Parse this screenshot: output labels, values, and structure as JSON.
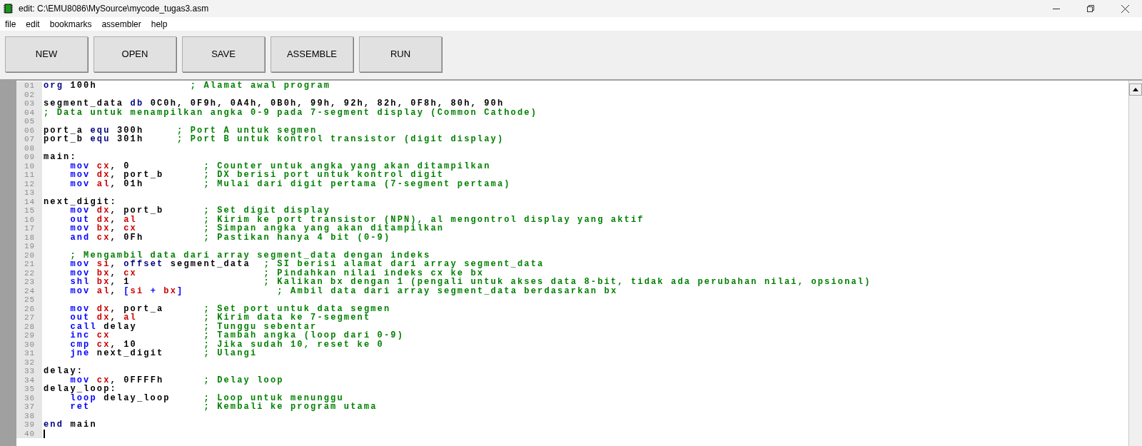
{
  "window": {
    "title": "edit: C:\\EMU8086\\MySource\\mycode_tugas3.asm"
  },
  "menu": [
    "file",
    "edit",
    "bookmarks",
    "assembler",
    "help"
  ],
  "toolbar": [
    "NEW",
    "OPEN",
    "SAVE",
    "ASSEMBLE",
    "RUN"
  ],
  "editor": {
    "lines": [
      {
        "number": "01",
        "cursor": false,
        "tokens": [
          {
            "text": "org",
            "kind": "directive"
          },
          {
            "text": " 100h              ",
            "kind": "plain"
          }
        ],
        "comment": "; Alamat awal program"
      },
      {
        "number": "02",
        "cursor": false
      },
      {
        "number": "03",
        "cursor": false,
        "tokens": [
          {
            "text": "segment_data ",
            "kind": "plain"
          },
          {
            "text": "db",
            "kind": "directive"
          },
          {
            "text": " 0C0h, 0F9h, 0A4h, 0B0h, 99h, 92h, 82h, 0F8h, 80h, 90h",
            "kind": "plain"
          }
        ]
      },
      {
        "number": "04",
        "cursor": false,
        "comment": "; Data untuk menampilkan angka 0-9 pada 7-segment display (Common Cathode)"
      },
      {
        "number": "05",
        "cursor": false
      },
      {
        "number": "06",
        "cursor": false,
        "tokens": [
          {
            "text": "port_a ",
            "kind": "plain"
          },
          {
            "text": "equ",
            "kind": "directive"
          },
          {
            "text": " 300h     ",
            "kind": "plain"
          }
        ],
        "comment": "; Port A untuk segmen"
      },
      {
        "number": "07",
        "cursor": false,
        "tokens": [
          {
            "text": "port_b ",
            "kind": "plain"
          },
          {
            "text": "equ",
            "kind": "directive"
          },
          {
            "text": " 301h     ",
            "kind": "plain"
          }
        ],
        "comment": "; Port B untuk kontrol transistor (digit display)"
      },
      {
        "number": "08",
        "cursor": false
      },
      {
        "number": "09",
        "cursor": false,
        "tokens": [
          {
            "text": "main:",
            "kind": "plain"
          }
        ]
      },
      {
        "number": "10",
        "cursor": false,
        "tokens": [
          {
            "text": "    mov",
            "kind": "instruction"
          },
          {
            "text": " cx",
            "kind": "register"
          },
          {
            "text": ", 0           ",
            "kind": "plain"
          }
        ],
        "comment": "; Counter untuk angka yang akan ditampilkan"
      },
      {
        "number": "11",
        "cursor": false,
        "tokens": [
          {
            "text": "    mov",
            "kind": "instruction"
          },
          {
            "text": " dx",
            "kind": "register"
          },
          {
            "text": ", port_b      ",
            "kind": "plain"
          }
        ],
        "comment": "; DX berisi port untuk kontrol digit"
      },
      {
        "number": "12",
        "cursor": false,
        "tokens": [
          {
            "text": "    mov",
            "kind": "instruction"
          },
          {
            "text": " al",
            "kind": "register"
          },
          {
            "text": ", 01h         ",
            "kind": "plain"
          }
        ],
        "comment": "; Mulai dari digit pertama (7-segment pertama)"
      },
      {
        "number": "13",
        "cursor": false
      },
      {
        "number": "14",
        "cursor": false,
        "tokens": [
          {
            "text": "next_digit:",
            "kind": "plain"
          }
        ]
      },
      {
        "number": "15",
        "cursor": false,
        "tokens": [
          {
            "text": "    mov",
            "kind": "instruction"
          },
          {
            "text": " dx",
            "kind": "register"
          },
          {
            "text": ", port_b      ",
            "kind": "plain"
          }
        ],
        "comment": "; Set digit display"
      },
      {
        "number": "16",
        "cursor": false,
        "tokens": [
          {
            "text": "    out",
            "kind": "instruction"
          },
          {
            "text": " dx",
            "kind": "register"
          },
          {
            "text": ", ",
            "kind": "plain"
          },
          {
            "text": "al          ",
            "kind": "register"
          }
        ],
        "comment": "; Kirim ke port transistor (NPN), al mengontrol display yang aktif"
      },
      {
        "number": "17",
        "cursor": false,
        "tokens": [
          {
            "text": "    mov",
            "kind": "instruction"
          },
          {
            "text": " bx",
            "kind": "register"
          },
          {
            "text": ", ",
            "kind": "plain"
          },
          {
            "text": "cx          ",
            "kind": "register"
          }
        ],
        "comment": "; Simpan angka yang akan ditampilkan"
      },
      {
        "number": "18",
        "cursor": false,
        "tokens": [
          {
            "text": "    and",
            "kind": "instruction"
          },
          {
            "text": " cx",
            "kind": "register"
          },
          {
            "text": ", 0Fh         ",
            "kind": "plain"
          }
        ],
        "comment": "; Pastikan hanya 4 bit (0-9)"
      },
      {
        "number": "19",
        "cursor": false
      },
      {
        "number": "20",
        "cursor": false,
        "comment": "    ; Mengambil data dari array segment_data dengan indeks"
      },
      {
        "number": "21",
        "cursor": false,
        "tokens": [
          {
            "text": "    mov",
            "kind": "instruction"
          },
          {
            "text": " si",
            "kind": "register"
          },
          {
            "text": ", ",
            "kind": "plain"
          },
          {
            "text": "offset",
            "kind": "directive"
          },
          {
            "text": " segment_data  ",
            "kind": "plain"
          }
        ],
        "comment": "; SI berisi alamat dari array segment_data"
      },
      {
        "number": "22",
        "cursor": false,
        "tokens": [
          {
            "text": "    mov",
            "kind": "instruction"
          },
          {
            "text": " bx",
            "kind": "register"
          },
          {
            "text": ", ",
            "kind": "plain"
          },
          {
            "text": "cx                   ",
            "kind": "register"
          }
        ],
        "comment": "; Pindahkan nilai indeks cx ke bx"
      },
      {
        "number": "23",
        "cursor": false,
        "tokens": [
          {
            "text": "    shl",
            "kind": "instruction"
          },
          {
            "text": " bx",
            "kind": "register"
          },
          {
            "text": ", 1                    ",
            "kind": "plain"
          }
        ],
        "comment": "; Kalikan bx dengan 1 (pengali untuk akses data 8-bit, tidak ada perubahan nilai, opsional)"
      },
      {
        "number": "24",
        "cursor": false,
        "tokens": [
          {
            "text": "    mov",
            "kind": "instruction"
          },
          {
            "text": " al",
            "kind": "register"
          },
          {
            "text": ", ",
            "kind": "plain"
          },
          {
            "text": "[",
            "kind": "symbol"
          },
          {
            "text": "si",
            "kind": "register"
          },
          {
            "text": " + ",
            "kind": "symbol"
          },
          {
            "text": "bx",
            "kind": "register"
          },
          {
            "text": "]              ",
            "kind": "symbol"
          }
        ],
        "comment": "; Ambil data dari array segment_data berdasarkan bx"
      },
      {
        "number": "25",
        "cursor": false
      },
      {
        "number": "26",
        "cursor": false,
        "tokens": [
          {
            "text": "    mov",
            "kind": "instruction"
          },
          {
            "text": " dx",
            "kind": "register"
          },
          {
            "text": ", port_a      ",
            "kind": "plain"
          }
        ],
        "comment": "; Set port untuk data segmen"
      },
      {
        "number": "27",
        "cursor": false,
        "tokens": [
          {
            "text": "    out",
            "kind": "instruction"
          },
          {
            "text": " dx",
            "kind": "register"
          },
          {
            "text": ", ",
            "kind": "plain"
          },
          {
            "text": "al          ",
            "kind": "register"
          }
        ],
        "comment": "; Kirim data ke 7-segment"
      },
      {
        "number": "28",
        "cursor": false,
        "tokens": [
          {
            "text": "    call",
            "kind": "instruction"
          },
          {
            "text": " delay          ",
            "kind": "plain"
          }
        ],
        "comment": "; Tunggu sebentar"
      },
      {
        "number": "29",
        "cursor": false,
        "tokens": [
          {
            "text": "    inc",
            "kind": "instruction"
          },
          {
            "text": " cx              ",
            "kind": "register"
          }
        ],
        "comment": "; Tambah angka (loop dari 0-9)"
      },
      {
        "number": "30",
        "cursor": false,
        "tokens": [
          {
            "text": "    cmp",
            "kind": "instruction"
          },
          {
            "text": " cx",
            "kind": "register"
          },
          {
            "text": ", 10          ",
            "kind": "plain"
          }
        ],
        "comment": "; Jika sudah 10, reset ke 0"
      },
      {
        "number": "31",
        "cursor": false,
        "tokens": [
          {
            "text": "    jne",
            "kind": "instruction"
          },
          {
            "text": " next_digit      ",
            "kind": "plain"
          }
        ],
        "comment": "; Ulangi"
      },
      {
        "number": "32",
        "cursor": false
      },
      {
        "number": "33",
        "cursor": false,
        "tokens": [
          {
            "text": "delay:",
            "kind": "plain"
          }
        ]
      },
      {
        "number": "34",
        "cursor": false,
        "tokens": [
          {
            "text": "    mov",
            "kind": "instruction"
          },
          {
            "text": " cx",
            "kind": "register"
          },
          {
            "text": ", 0FFFFh      ",
            "kind": "plain"
          }
        ],
        "comment": "; Delay loop"
      },
      {
        "number": "35",
        "cursor": false,
        "tokens": [
          {
            "text": "delay_loop:",
            "kind": "plain"
          }
        ]
      },
      {
        "number": "36",
        "cursor": false,
        "tokens": [
          {
            "text": "    loop",
            "kind": "instruction"
          },
          {
            "text": " delay_loop     ",
            "kind": "plain"
          }
        ],
        "comment": "; Loop untuk menunggu"
      },
      {
        "number": "37",
        "cursor": false,
        "tokens": [
          {
            "text": "    ret                 ",
            "kind": "instruction"
          }
        ],
        "comment": "; Kembali ke program utama"
      },
      {
        "number": "38",
        "cursor": false
      },
      {
        "number": "39",
        "cursor": false,
        "tokens": [
          {
            "text": "end",
            "kind": "directive"
          },
          {
            "text": " main",
            "kind": "plain"
          }
        ]
      },
      {
        "number": "40",
        "cursor": true
      }
    ]
  }
}
